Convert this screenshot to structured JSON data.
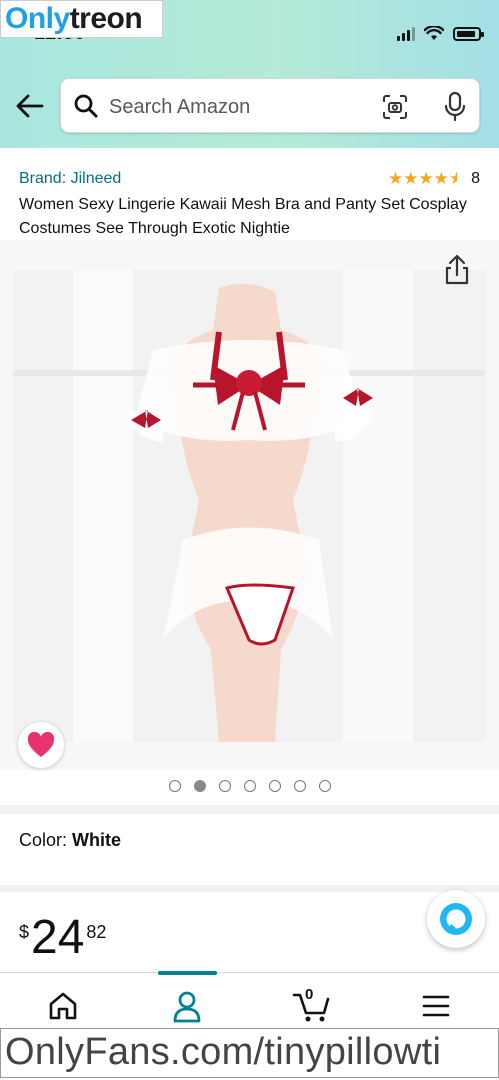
{
  "watermark": {
    "top_part1": "Only",
    "top_part2": "treon",
    "bottom": "OnlyFans.com/tinypillowti"
  },
  "status_bar": {
    "time": "12:30"
  },
  "search": {
    "placeholder": "Search Amazon"
  },
  "product": {
    "brand": "Brand: Jilneed",
    "rating_stars": 4.5,
    "rating_count": "8",
    "title": "Women Sexy Lingerie Kawaii Mesh Bra and Panty Set Cosplay Costumes See Through Exotic Nightie",
    "image_count": 7,
    "active_image_index": 1,
    "color_label": "Color:",
    "color_value": "White",
    "price_symbol": "$",
    "price_whole": "24",
    "price_fraction": "82"
  },
  "bottom_nav": {
    "items": [
      "home-icon",
      "account-icon",
      "cart-icon",
      "menu-icon"
    ],
    "active": "account-icon",
    "cart_count": "0"
  },
  "colors": {
    "header_gradient": "#a8e6df",
    "link": "#007185",
    "star": "#ffa41c",
    "nav_active": "#008296",
    "heart": "#e8336e"
  }
}
